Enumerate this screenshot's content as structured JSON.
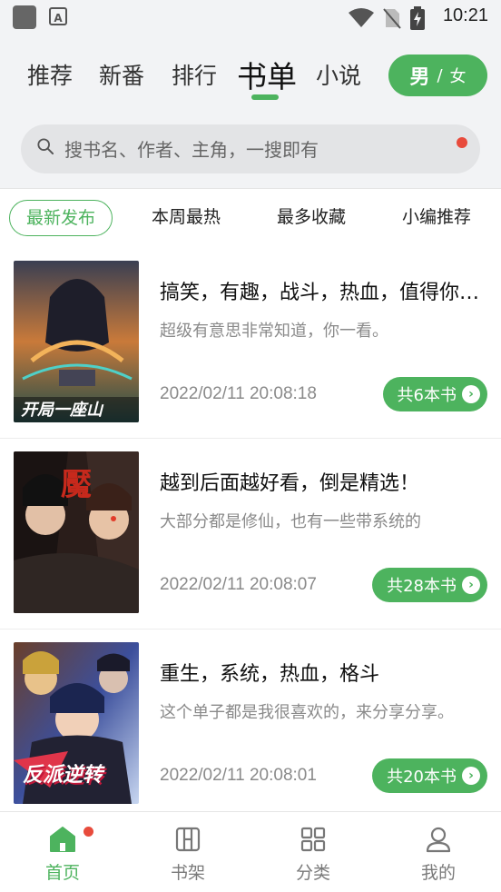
{
  "status_bar": {
    "time": "10:21",
    "icons": [
      "app-square-icon",
      "a-text-icon",
      "wifi-icon",
      "no-sim-icon",
      "battery-charging-icon"
    ]
  },
  "header": {
    "tabs": [
      {
        "label": "推荐",
        "active": false
      },
      {
        "label": "新番",
        "active": false
      },
      {
        "label": "排行",
        "active": false
      },
      {
        "label": "书单",
        "active": true
      },
      {
        "label": "小说",
        "active": false
      }
    ],
    "gender_toggle": {
      "male": "男",
      "separator": "/",
      "female": "女"
    }
  },
  "search": {
    "placeholder": "搜书名、作者、主角，一搜即有"
  },
  "filters": [
    {
      "label": "最新发布",
      "active": true
    },
    {
      "label": "本周最热",
      "active": false
    },
    {
      "label": "最多收藏",
      "active": false
    },
    {
      "label": "小编推荐",
      "active": false
    }
  ],
  "booklists": [
    {
      "title": "搞笑，有趣，战斗，热血，值得你一看",
      "desc": "超级有意思非常知道，你一看。",
      "date": "2022/02/11 20:08:18",
      "count_label": "共6本书",
      "cover_text": "开局一座山"
    },
    {
      "title": "越到后面越好看，倒是精选！",
      "desc": "大部分都是修仙，也有一些带系统的",
      "date": "2022/02/11 20:08:07",
      "count_label": "共28本书",
      "cover_text": ""
    },
    {
      "title": "重生，系统，热血，格斗",
      "desc": "这个单子都是我很喜欢的，来分享分享。",
      "date": "2022/02/11 20:08:01",
      "count_label": "共20本书",
      "cover_text": "反派逆转"
    }
  ],
  "bottom_nav": [
    {
      "label": "首页",
      "icon": "home-icon",
      "active": true,
      "badge": true
    },
    {
      "label": "书架",
      "icon": "bookshelf-icon",
      "active": false
    },
    {
      "label": "分类",
      "icon": "category-grid-icon",
      "active": false
    },
    {
      "label": "我的",
      "icon": "profile-icon",
      "active": false
    }
  ],
  "colors": {
    "accent": "#4db35e",
    "badge": "#e84b3c",
    "background": "#f2f3f5"
  }
}
